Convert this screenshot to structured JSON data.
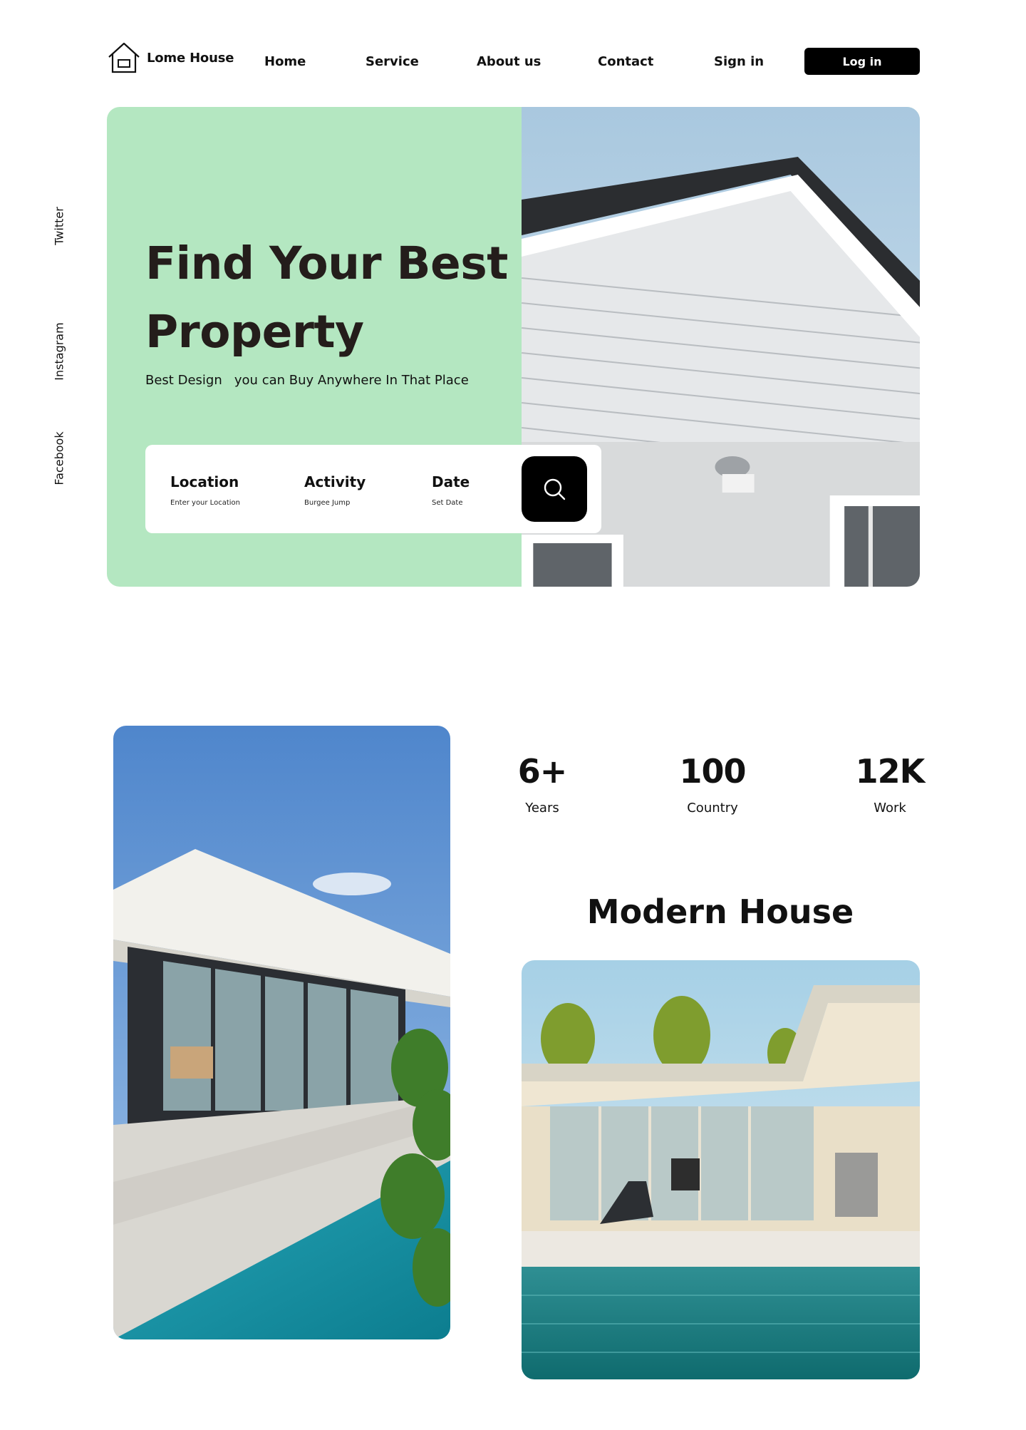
{
  "brand": {
    "name": "Lome House",
    "logo_icon": "house-icon"
  },
  "nav": {
    "links": [
      "Home",
      "Service",
      "About us",
      "Contact",
      "Sign in"
    ],
    "login_label": "Log in"
  },
  "social": [
    "Twitter",
    "Instagram",
    "Facebook"
  ],
  "hero": {
    "title_line1": "Find Your Best",
    "title_line2": "Property",
    "subtitle": "Best Design   you can Buy Anywhere In That Place",
    "search": {
      "fields": [
        {
          "label": "Location",
          "hint": "Enter your Location"
        },
        {
          "label": "Activity",
          "hint": "Burgee Jump"
        },
        {
          "label": "Date",
          "hint": "Set Date"
        }
      ],
      "button_icon": "search-icon"
    }
  },
  "stats": [
    {
      "value": "6+",
      "label": "Years"
    },
    {
      "value": "100",
      "label": "Country"
    },
    {
      "value": "12K",
      "label": "Work"
    }
  ],
  "feature": {
    "title": "Modern House"
  },
  "colors": {
    "hero_bg": "#b4e7c1",
    "button_bg": "#000000",
    "text": "#111111",
    "title_text": "#241d1b"
  }
}
